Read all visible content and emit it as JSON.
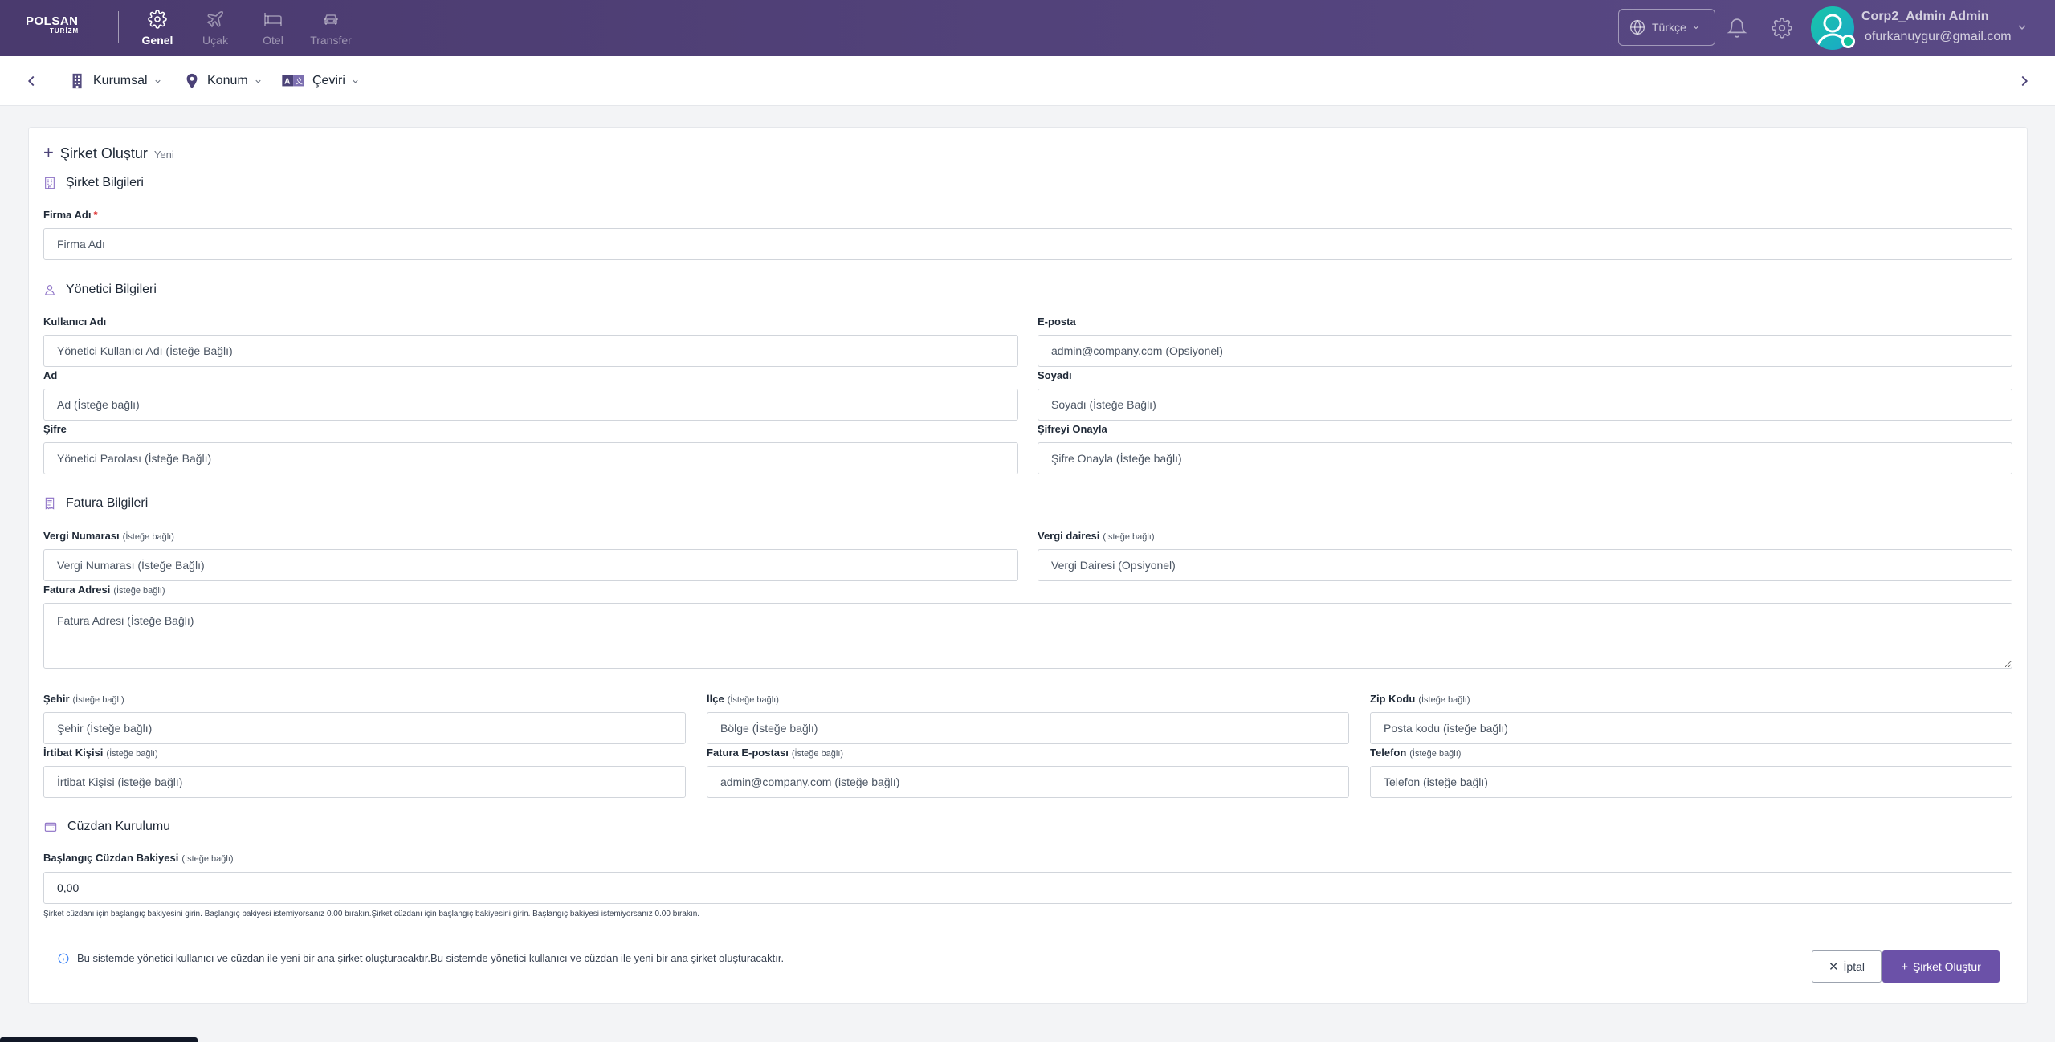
{
  "brand": {
    "name": "POLSAN",
    "sub": "TURİZM"
  },
  "topnav": [
    {
      "label": "Genel",
      "icon": "gear-icon",
      "active": true
    },
    {
      "label": "Uçak",
      "icon": "plane-icon",
      "active": false
    },
    {
      "label": "Otel",
      "icon": "bed-icon",
      "active": false
    },
    {
      "label": "Transfer",
      "icon": "car-icon",
      "active": false
    }
  ],
  "header": {
    "language": "Türkçe",
    "user_name": "Corp2_Admin Admin",
    "user_email": "ofurkanuygur@gmail.com"
  },
  "subnav": [
    {
      "label": "Kurumsal",
      "icon": "building-icon"
    },
    {
      "label": "Konum",
      "icon": "map-pin-icon"
    },
    {
      "label": "Çeviri",
      "icon": "translate-icon"
    }
  ],
  "form": {
    "title": "Şirket Oluştur",
    "title_badge": "Yeni",
    "sections": {
      "company": "Şirket Bilgileri",
      "admin": "Yönetici Bilgileri",
      "invoice": "Fatura Bilgileri",
      "wallet": "Cüzdan Kurulumu"
    },
    "fields": {
      "company_name": {
        "label": "Firma Adı",
        "required_mark": "*",
        "placeholder": "Firma Adı"
      },
      "username": {
        "label": "Kullanıcı Adı",
        "placeholder": "Yönetici Kullanıcı Adı (İsteğe Bağlı)"
      },
      "email": {
        "label": "E-posta",
        "placeholder": "admin@company.com (Opsiyonel)"
      },
      "first_name": {
        "label": "Ad",
        "placeholder": "Ad (İsteğe bağlı)"
      },
      "last_name": {
        "label": "Soyadı",
        "placeholder": "Soyadı (İsteğe Bağlı)"
      },
      "password": {
        "label": "Şifre",
        "placeholder": "Yönetici Parolası (İsteğe Bağlı)"
      },
      "password_confirm": {
        "label": "Şifreyi Onayla",
        "placeholder": "Şifre Onayla (İsteğe bağlı)"
      },
      "tax_number": {
        "label": "Vergi Numarası",
        "optional": "(İsteğe bağlı)",
        "placeholder": "Vergi Numarası (İsteğe Bağlı)"
      },
      "tax_office": {
        "label": "Vergi dairesi",
        "optional": "(İsteğe bağlı)",
        "placeholder": "Vergi Dairesi (Opsiyonel)"
      },
      "invoice_address": {
        "label": "Fatura Adresi",
        "optional": "(İsteğe bağlı)",
        "placeholder": "Fatura Adresi (İsteğe Bağlı)"
      },
      "city": {
        "label": "Şehir",
        "optional": "(İsteğe bağlı)",
        "placeholder": "Şehir (İsteğe bağlı)"
      },
      "district": {
        "label": "İlçe",
        "optional": "(İsteğe bağlı)",
        "placeholder": "Bölge (İsteğe bağlı)"
      },
      "zip": {
        "label": "Zip Kodu",
        "optional": "(İsteğe bağlı)",
        "placeholder": "Posta kodu (isteğe bağlı)"
      },
      "contact": {
        "label": "İrtibat Kişisi",
        "optional": "(İsteğe bağlı)",
        "placeholder": "İrtibat Kişisi (isteğe bağlı)"
      },
      "invoice_email": {
        "label": "Fatura E-postası",
        "optional": "(İsteğe bağlı)",
        "placeholder": "admin@company.com (isteğe bağlı)"
      },
      "phone": {
        "label": "Telefon",
        "optional": "(İsteğe bağlı)",
        "placeholder": "Telefon (isteğe bağlı)"
      },
      "wallet_balance": {
        "label": "Başlangıç Cüzdan Bakiyesi",
        "optional": "(İsteğe bağlı)",
        "value": "0,00"
      }
    },
    "wallet_hint": "Şirket cüzdanı için başlangıç bakiyesini girin. Başlangıç bakiyesi istemiyorsanız 0.00 bırakın.Şirket cüzdanı için başlangıç bakiyesini girin. Başlangıç bakiyesi istemiyorsanız 0.00 bırakın.",
    "info_text": "Bu sistemde yönetici kullanıcı ve cüzdan ile yeni bir ana şirket oluşturacaktır.Bu sistemde yönetici kullanıcı ve cüzdan ile yeni bir ana şirket oluşturacaktır.",
    "cancel_label": "İptal",
    "create_label": "Şirket Oluştur"
  },
  "colors": {
    "header": "#4a3a6e",
    "accent": "#6b51a8",
    "required": "#dc2626",
    "info": "#3b82f6"
  }
}
